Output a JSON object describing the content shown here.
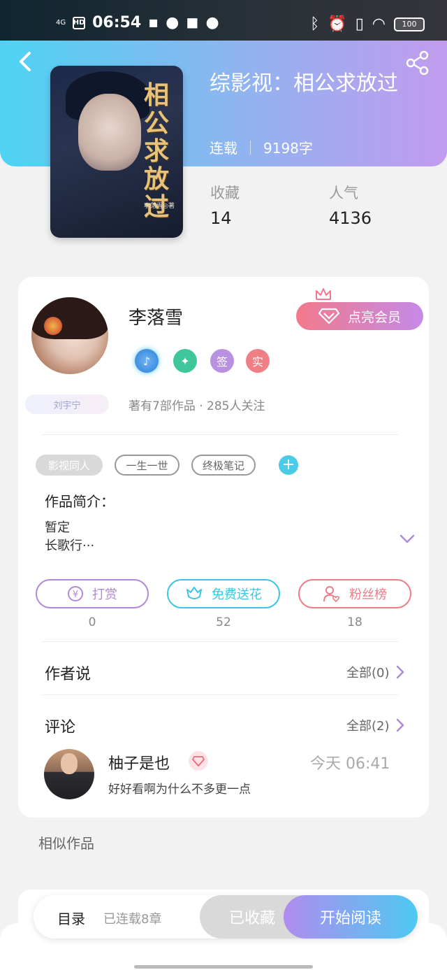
{
  "status_bar": {
    "network": "4G",
    "hd": "HD",
    "time": "06:54",
    "battery": "100"
  },
  "book": {
    "title": "综影视：相公求放过",
    "status": "连载",
    "word_count": "9198字",
    "cover_calligraphy": "相公求放过",
    "cover_author_mark": "李落雪◎著",
    "stats": [
      {
        "label": "收藏",
        "value": "14"
      },
      {
        "label": "人气",
        "value": "4136"
      }
    ]
  },
  "author": {
    "name": "李落雪",
    "vip_button": "点亮会员",
    "badges": [
      "签",
      "实"
    ],
    "stats_text": "著有7部作品 · 285人关注",
    "fan_tag": "刘宇宁"
  },
  "tags": {
    "items": [
      "影视同人",
      "一生一世",
      "终极笔记"
    ]
  },
  "intro": {
    "label": "作品简介：",
    "line1": "暂定",
    "line2": "长歌行···"
  },
  "actions": [
    {
      "label": "打赏",
      "count": "0",
      "color": "#b08ad8"
    },
    {
      "label": "免费送花",
      "count": "52",
      "color": "#39c5e4"
    },
    {
      "label": "粉丝榜",
      "count": "18",
      "color": "#ee7c86"
    }
  ],
  "author_says": {
    "title": "作者说",
    "more": "全部(0)"
  },
  "comments": {
    "title": "评论",
    "more": "全部(2)",
    "items": [
      {
        "name": "柚子是也",
        "time": "今天 06:41",
        "text": "好好看啊为什么不多更一点"
      }
    ]
  },
  "similar": {
    "title": "相似作品"
  },
  "bottom_bar": {
    "toc": "目录",
    "chapters": "已连载8章",
    "favorited": "已收藏",
    "start_reading": "开始阅读"
  },
  "colors": {
    "header_gradient_start": "#4ed3f3",
    "header_gradient_end": "#c39bee",
    "accent_pink": "#f27a8b",
    "accent_cyan": "#4ccbe8"
  }
}
